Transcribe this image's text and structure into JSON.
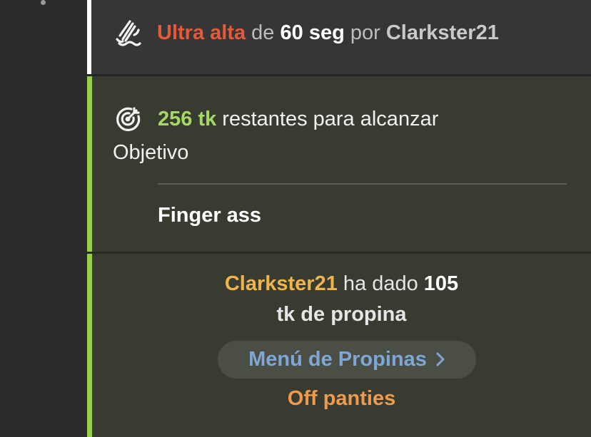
{
  "vibe_message": {
    "level": "Ultra alta",
    "connector": "de",
    "duration": "60 seg",
    "by_word": "por",
    "user": "Clarkster21",
    "icon": "vibration-wave-icon"
  },
  "goal_message": {
    "amount": "256 tk",
    "text_after_amount": "restantes para alcanzar",
    "line2": "Objetivo",
    "description": "Finger ass",
    "icon": "target-icon"
  },
  "tip_message": {
    "user": "Clarkster21",
    "text_mid": "ha dado",
    "amount": "105",
    "line2": "tk de propina",
    "menu_button_label": "Menú de Propinas",
    "tip_item": "Off panties"
  },
  "colors": {
    "vibe_level": "#e8593a",
    "goal_amount": "#a6d963",
    "goal_border": "#9acd4b",
    "tip_user": "#f0b44c",
    "menu_link": "#7ea7d6",
    "tip_item": "#ef9a4f"
  }
}
